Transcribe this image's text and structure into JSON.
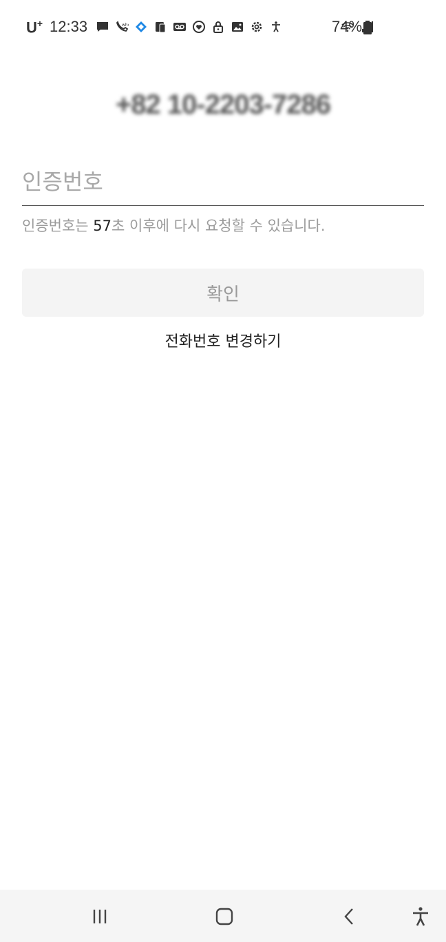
{
  "status_bar": {
    "carrier": "U",
    "carrier_sup": "+",
    "time": "12:33",
    "battery_percent": "74%",
    "icons": [
      "message-icon",
      "phone-who-icon",
      "diamond-app-icon",
      "phone-mirror-icon",
      "voicemail-icon",
      "heart-circle-icon",
      "lock-icon",
      "gallery-icon",
      "settings-icon",
      "accessibility-icon"
    ],
    "right_icons": [
      "wifi-icon",
      "signal-icon"
    ]
  },
  "verification": {
    "phone_number": "+82 10-2203-7286",
    "code_placeholder": "인증번호",
    "code_value": "",
    "helper_prefix": "인증번호는 ",
    "helper_seconds": "57",
    "helper_suffix": "초 이후에 다시 요청할 수 있습니다.",
    "confirm_label": "확인",
    "change_phone_label": "전화번호 변경하기"
  },
  "nav_bar": {
    "buttons": [
      "recent-apps",
      "home",
      "back",
      "accessibility"
    ]
  },
  "colors": {
    "placeholder": "#a8a8a8",
    "helper_text": "#9b9b9b",
    "button_bg": "#f4f4f4",
    "button_text": "#9a9a9a",
    "nav_bg": "#f5f5f5"
  }
}
